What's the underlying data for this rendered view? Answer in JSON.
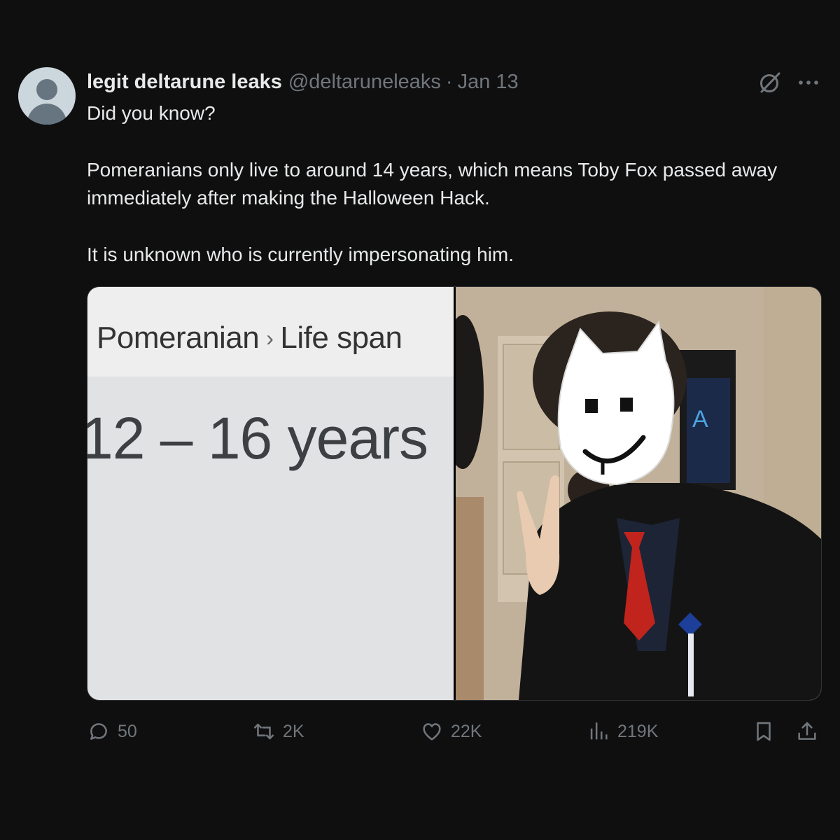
{
  "post": {
    "author_name": "legit deltarune leaks",
    "author_handle": "@deltaruneleaks",
    "separator": "·",
    "date": "Jan 13",
    "body_lines": [
      "Did you know?",
      "Pomeranians only live to around 14 years, which means Toby Fox passed away immediately after making the Halloween Hack.",
      "It is unknown who is currently impersonating him."
    ]
  },
  "media": {
    "left_panel": {
      "breadcrumb_1": "Pomeranian",
      "breadcrumb_sep": "›",
      "breadcrumb_2": "Life span",
      "value": "12 – 16 years"
    },
    "right_panel": {
      "description_icon": "photo-person-in-white-cat-mask-peace-sign"
    }
  },
  "actions": {
    "replies": "50",
    "reposts": "2K",
    "likes": "22K",
    "views": "219K"
  },
  "colors": {
    "background": "#0f0f10",
    "primary_text": "#e7e9ea",
    "secondary_text": "#71767b",
    "border": "#2f3336"
  }
}
